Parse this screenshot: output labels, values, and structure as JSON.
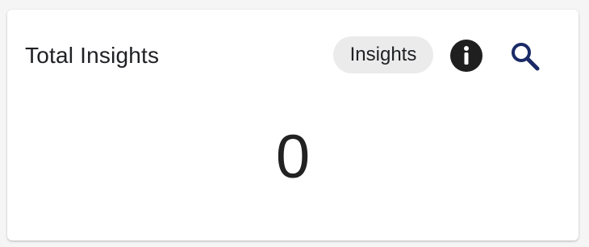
{
  "card": {
    "title": "Total Insights",
    "chip_label": "Insights",
    "value": "0",
    "icons": {
      "info": "info-icon",
      "search": "search-icon"
    },
    "colors": {
      "search_icon": "#1a2a66",
      "info_icon": "#1f1f1f",
      "chip_bg": "#ebebeb"
    }
  }
}
